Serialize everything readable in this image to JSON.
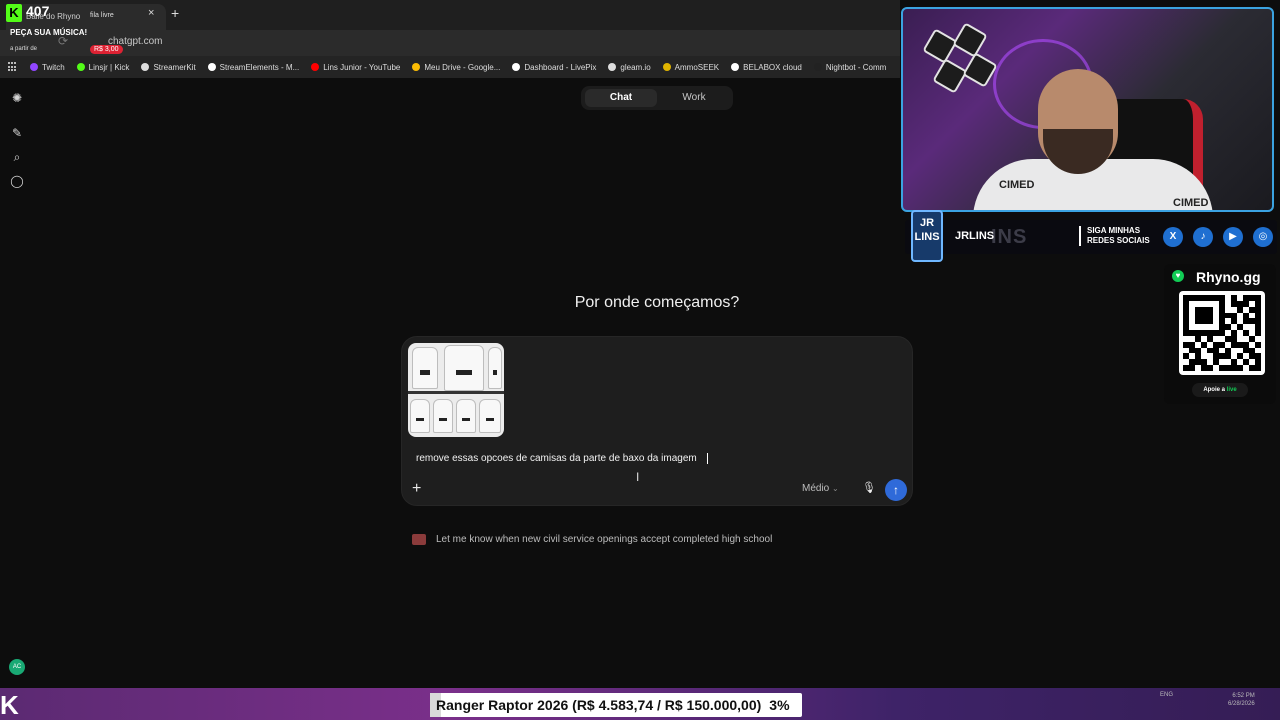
{
  "browser": {
    "tab_title": "Baile do Rhyno",
    "tab_badge": "fila livre",
    "url": "chatgpt.com",
    "bookmarks": [
      {
        "label": "Twitch",
        "color": "#9146ff"
      },
      {
        "label": "Linsjr | Kick",
        "color": "#53fc18"
      },
      {
        "label": "StreamerKit",
        "color": "#dddddd"
      },
      {
        "label": "StreamElements - M...",
        "color": "#ffffff"
      },
      {
        "label": "Lins Junior - YouTube",
        "color": "#ff0000"
      },
      {
        "label": "Meu Drive - Google...",
        "color": "#fbbc04"
      },
      {
        "label": "Dashboard - LivePix",
        "color": "#ffffff"
      },
      {
        "label": "gleam.io",
        "color": "#dddddd"
      },
      {
        "label": "AmmoSEEK",
        "color": "#e0b400"
      },
      {
        "label": "BELABOX cloud",
        "color": "#ffffff"
      },
      {
        "label": "Nightbot - Comm",
        "color": "#222222"
      }
    ]
  },
  "overlay_top": {
    "viewers": "407",
    "kick_letter": "K",
    "request_title": "PEÇA SUA MÚSICA!",
    "from_label": "a partir de",
    "price": "R$ 3,00"
  },
  "chat": {
    "sidebar_icons": [
      "openai-logo-icon",
      "new-chat-icon",
      "search-icon",
      "chat-bubble-icon"
    ],
    "avatar_initials": "AC",
    "mode_chat": "Chat",
    "mode_work": "Work",
    "heading": "Por onde começamos?",
    "message": "remove essas opcoes de camisas da parte de baxo da imagem",
    "model_label": "Médio",
    "suggestion": "Let me know when new civil service openings accept completed high school"
  },
  "webcam": {
    "shirt_text": "CIMED"
  },
  "social": {
    "logo_text": "JR LINS",
    "name": "JRLINS",
    "ghost": "INS",
    "follow_text": "SIGA MINHAS REDES SOCIAIS",
    "icons": [
      {
        "name": "x-twitter-icon",
        "glyph": "X",
        "color": "#1f6fd1"
      },
      {
        "name": "tiktok-icon",
        "glyph": "♪",
        "color": "#1f6fd1"
      },
      {
        "name": "youtube-icon",
        "glyph": "▶",
        "color": "#1f6fd1"
      },
      {
        "name": "instagram-icon",
        "glyph": "◎",
        "color": "#1f6fd1"
      }
    ]
  },
  "rhyno": {
    "title": "Rhyno.gg",
    "button_prefix": "Apoie a",
    "button_highlight": "live"
  },
  "goal": {
    "label": "Ranger Raptor 2026 (R$ 4.583,74 / R$ 150.000,00)",
    "percent_text": "3%",
    "progress": 0.03
  },
  "tray": {
    "lang": "ENG",
    "time": "6:52 PM",
    "date": "6/28/2026"
  }
}
